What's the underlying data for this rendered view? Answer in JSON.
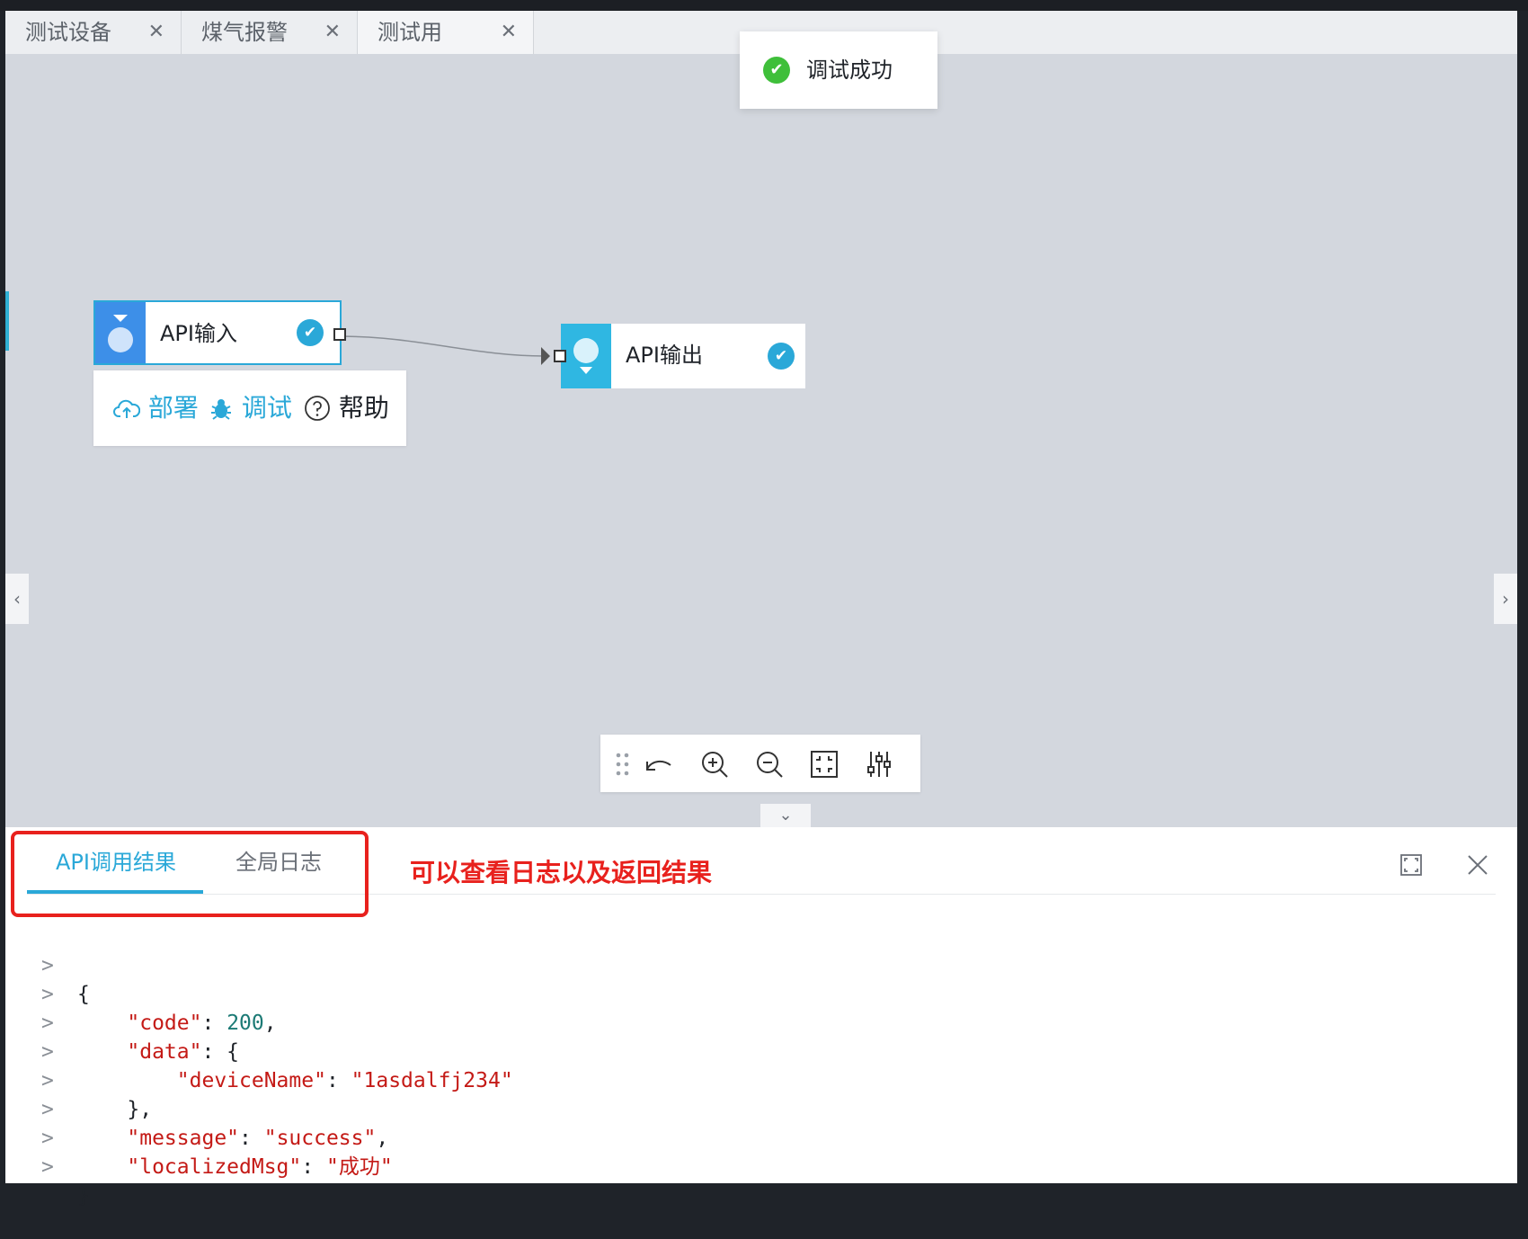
{
  "tabs": [
    {
      "label": "测试设备",
      "close": "✕"
    },
    {
      "label": "煤气报警",
      "close": "✕"
    },
    {
      "label": "测试用",
      "close": "✕"
    }
  ],
  "toast": {
    "message": "调试成功",
    "icon": "success-check-icon"
  },
  "nodes": {
    "input": {
      "label": "API输入",
      "status_icon": "check-circle-icon"
    },
    "output": {
      "label": "API输出",
      "status_icon": "check-circle-icon"
    }
  },
  "node_actions": {
    "deploy": "部署",
    "debug": "调试",
    "help": "帮助"
  },
  "toolbar": {
    "tools": [
      "drag-handle-icon",
      "undo-icon",
      "zoom-in-icon",
      "zoom-out-icon",
      "fit-view-icon",
      "settings-sliders-icon"
    ]
  },
  "panel": {
    "tabs": [
      "API调用结果",
      "全局日志"
    ],
    "annotation": "可以查看日志以及返回结果",
    "controls": [
      "maximize-icon",
      "close-icon"
    ]
  },
  "result_lines": [
    {
      "prompt": ">",
      "text": "{"
    },
    {
      "prompt": ">",
      "text": "    \"code\": 200,"
    },
    {
      "prompt": ">",
      "text": "    \"data\": {"
    },
    {
      "prompt": ">",
      "text": "        \"deviceName\": \"1asdalfj234\""
    },
    {
      "prompt": ">",
      "text": "    },"
    },
    {
      "prompt": ">",
      "text": "    \"message\": \"success\","
    },
    {
      "prompt": ">",
      "text": "    \"localizedMsg\": \"成功\""
    },
    {
      "prompt": ">",
      "text": "}"
    }
  ],
  "colors": {
    "accent": "#2aa8d8",
    "success": "#3fbf3a",
    "annotation": "#e8211d",
    "canvas": "#d3d7de"
  }
}
